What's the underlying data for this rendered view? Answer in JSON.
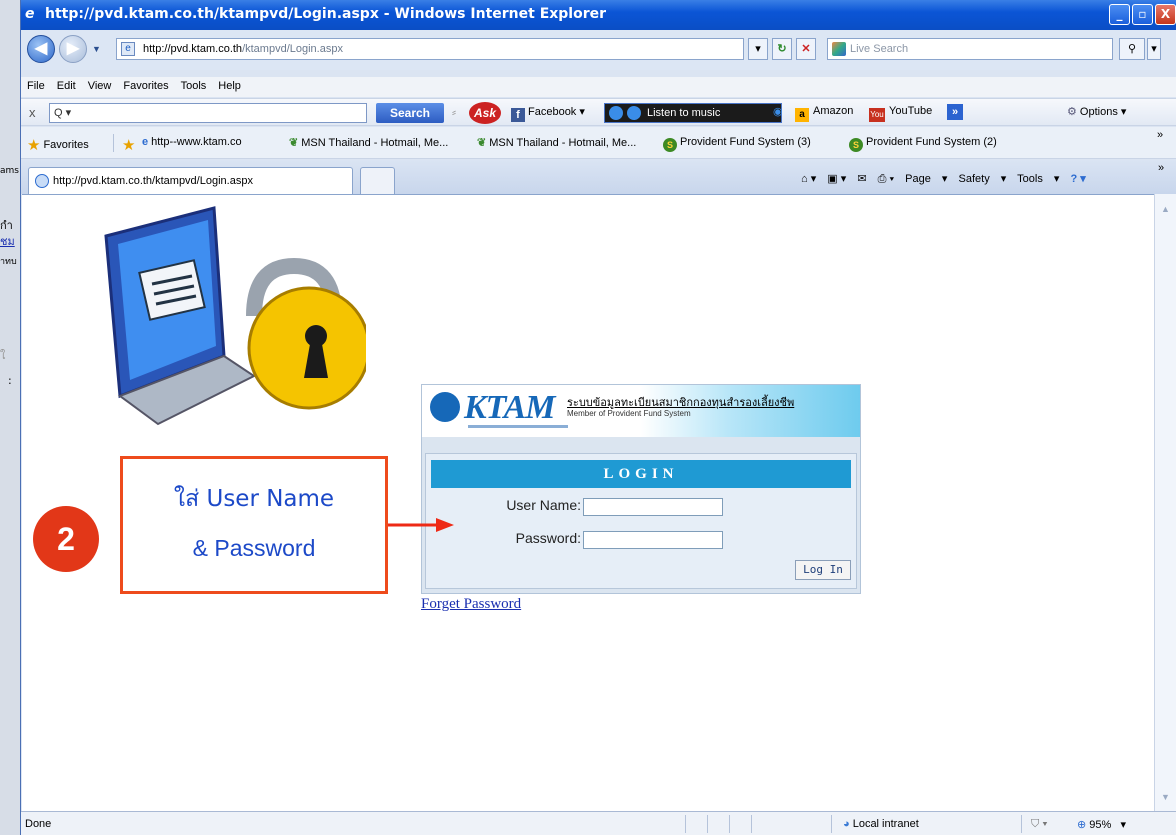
{
  "left_window": {
    "fragments": [
      "กำ",
      "ชม",
      "าทบ",
      "ams",
      "ใ",
      ":"
    ]
  },
  "window": {
    "title": "http://pvd.ktam.co.th/ktampvd/Login.aspx - Windows Internet Explorer",
    "minimize": "_",
    "maximize": "▫",
    "close": "X"
  },
  "address_bar": {
    "host": "http://pvd.ktam.co.th",
    "path": "/ktampvd/Login.aspx",
    "live_search_placeholder": "Live Search"
  },
  "menu": [
    "File",
    "Edit",
    "View",
    "Favorites",
    "Tools",
    "Help"
  ],
  "toolbar": {
    "search_button": "Search",
    "ask": "Ask",
    "facebook": "Facebook",
    "music": "Listen to music",
    "amazon": "Amazon",
    "youtube": "YouTube",
    "options": "Options"
  },
  "favorites": {
    "label": "Favorites",
    "items": [
      "http--www.ktam.co",
      "MSN Thailand - Hotmail, Me...",
      "MSN Thailand - Hotmail, Me...",
      "Provident Fund System (3)",
      "Provident Fund System (2)"
    ]
  },
  "tabs": {
    "active": "http://pvd.ktam.co.th/ktampvd/Login.aspx"
  },
  "command_bar": [
    "Page",
    "Safety",
    "Tools"
  ],
  "page": {
    "logo": "KTAM",
    "system_th": "ระบบข้อมูลทะเบียนสมาชิกกองทุนสำรองเลี้ยงชีพ",
    "system_en": "Member of Provident Fund System",
    "login_header": "LOGIN",
    "username_label": "User Name:",
    "password_label": "Password:",
    "login_button": "Log In",
    "forget_link": "Forget Password"
  },
  "annotation": {
    "step": "2",
    "line1": "ใส่ User Name",
    "line2": "& Password"
  },
  "status": {
    "text": "Done",
    "zone": "Local intranet",
    "zoom": "95%"
  }
}
